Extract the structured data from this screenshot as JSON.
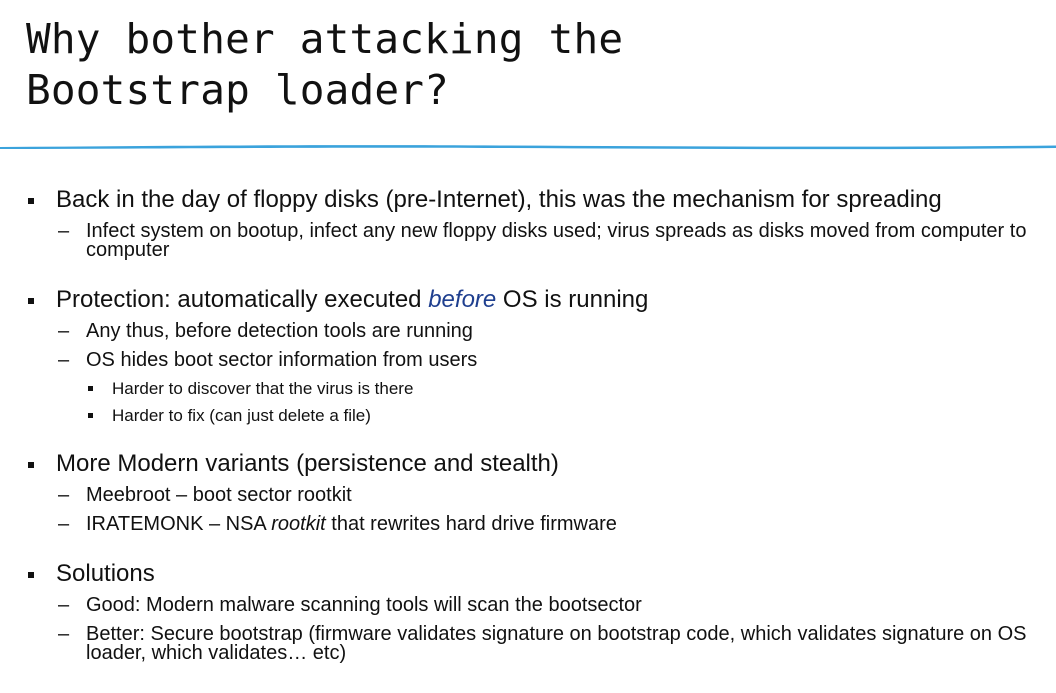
{
  "slide": {
    "title_lines": [
      "Why bother attacking the",
      "Bootstrap loader?"
    ],
    "rule_color": "#3ba3dc"
  },
  "bullets": [
    {
      "text": "Back in the day of floppy disks (pre-Internet), this was the mechanism for spreading",
      "sub": [
        {
          "text": "Infect system on bootup, infect any new floppy disks used; virus spreads as disks moved from computer to computer"
        }
      ]
    },
    {
      "text_pre": "Protection: automatically executed ",
      "text_emph": "before",
      "text_post": " OS is running",
      "emph_color": "#1f3f8f",
      "sub": [
        {
          "text": "Any thus, before detection tools are running"
        },
        {
          "text": "OS hides boot sector information from users",
          "sub": [
            {
              "text": "Harder to discover that the virus is there"
            },
            {
              "text": "Harder to fix (can just delete a file)"
            }
          ]
        }
      ]
    },
    {
      "text": "More Modern variants (persistence and stealth)",
      "sub": [
        {
          "text": "Meebroot – boot sector rootkit"
        },
        {
          "text_pre": "IRATEMONK – NSA ",
          "text_emph": "rootkit",
          "text_post": " that rewrites hard drive firmware"
        }
      ]
    },
    {
      "text": "Solutions",
      "sub": [
        {
          "text": "Good: Modern malware scanning tools will scan the bootsector"
        },
        {
          "text": "Better: Secure bootstrap (firmware validates signature on bootstrap code, which validates signature on OS loader, which validates… etc)"
        }
      ]
    }
  ],
  "dash": "–"
}
